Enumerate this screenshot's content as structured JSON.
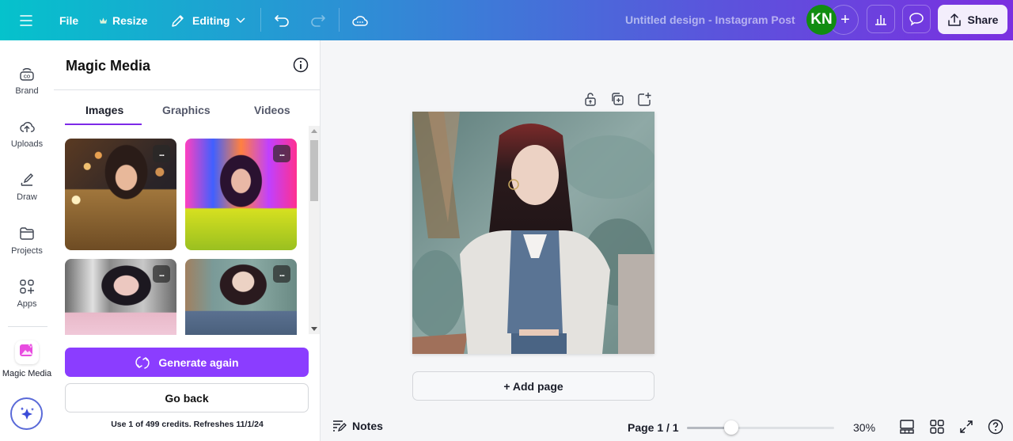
{
  "topbar": {
    "menu_icon": "hamburger-icon",
    "file_label": "File",
    "resize_label": "Resize",
    "editing_label": "Editing",
    "document_title": "Untitled design - Instagram Post",
    "avatar_initials": "KN",
    "avatar_color": "#118c11",
    "share_label": "Share",
    "gradient": [
      "#05c2cc",
      "#2d8fd5",
      "#5a55dc",
      "#7b2fe0"
    ]
  },
  "rail": {
    "items": [
      {
        "label": "Brand",
        "icon": "brand-icon"
      },
      {
        "label": "Uploads",
        "icon": "cloud-upload-icon"
      },
      {
        "label": "Draw",
        "icon": "pen-icon"
      },
      {
        "label": "Projects",
        "icon": "folder-icon"
      },
      {
        "label": "Apps",
        "icon": "apps-icon"
      },
      {
        "label": "Magic Media",
        "icon": "magic-media-icon"
      }
    ],
    "assistant_icon": "sparkles-icon"
  },
  "panel": {
    "title": "Magic Media",
    "tabs": [
      {
        "label": "Images",
        "active": true
      },
      {
        "label": "Graphics",
        "active": false
      },
      {
        "label": "Videos",
        "active": false
      }
    ],
    "images": [
      {
        "description": "woman in gold sequin dress, bokeh night lights",
        "more_label": "..."
      },
      {
        "description": "smiling woman in yellow jacket, neon city lights",
        "more_label": "..."
      },
      {
        "description": "woman in pink off-shoulder top, grey columns",
        "more_label": "..."
      },
      {
        "description": "woman in denim vest and white jacket, tropical leaves",
        "more_label": "..."
      }
    ],
    "generate_again_label": "Generate again",
    "go_back_label": "Go back",
    "credits_text": "Use 1 of 499 credits. Refreshes 11/1/24",
    "accent": "#8b3dff"
  },
  "canvas": {
    "page_image": "woman in denim vest and white jacket, tropical leaves",
    "add_page_label": "+ Add page"
  },
  "footer": {
    "notes_label": "Notes",
    "page_indicator": "Page 1 / 1",
    "zoom_percent": 30,
    "zoom_label": "30%",
    "zoom_slider_fraction": 0.3
  }
}
